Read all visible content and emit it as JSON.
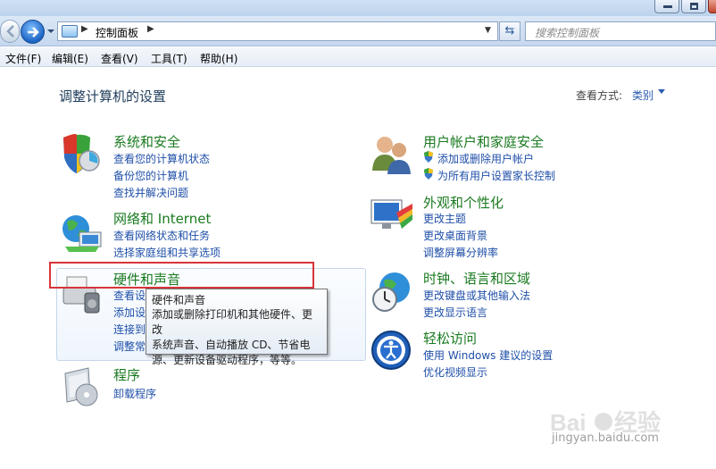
{
  "window": {
    "address": {
      "location": "控制面板"
    },
    "search": {
      "placeholder": "搜索控制面板"
    }
  },
  "menubar": {
    "items": [
      "文件(F)",
      "编辑(E)",
      "查看(V)",
      "工具(T)",
      "帮助(H)"
    ]
  },
  "main": {
    "title": "调整计算机的设置",
    "view_by_label": "查看方式:",
    "view_by_value": "类别",
    "categories": [
      {
        "title": "系统和安全",
        "links": [
          "查看您的计算机状态",
          "备份您的计算机",
          "查找并解决问题"
        ]
      },
      {
        "title": "网络和 Internet",
        "links": [
          "查看网络状态和任务",
          "选择家庭组和共享选项"
        ]
      },
      {
        "title": "硬件和声音",
        "links": [
          "查看设",
          "添加设",
          "连接到",
          "调整常"
        ]
      },
      {
        "title": "程序",
        "links": [
          "卸载程序"
        ]
      },
      {
        "title": "用户帐户和家庭安全",
        "links": [
          "添加或删除用户帐户",
          "为所有用户设置家长控制"
        ]
      },
      {
        "title": "外观和个性化",
        "links": [
          "更改主题",
          "更改桌面背景",
          "调整屏幕分辨率"
        ]
      },
      {
        "title": "时钟、语言和区域",
        "links": [
          "更改键盘或其他输入法",
          "更改显示语言"
        ]
      },
      {
        "title": "轻松访问",
        "links": [
          "使用 Windows 建议的设置",
          "优化视频显示"
        ]
      }
    ],
    "tooltip": {
      "title": "硬件和声音",
      "lines": [
        "添加或删除打印机和其他硬件、更改",
        "系统声音、自动播放 CD、节省电",
        "源、更新设备驱动程序，等等。"
      ]
    }
  },
  "watermark": {
    "text": "jingyan.baidu.com"
  },
  "colors": {
    "category_title": "#1a7a20",
    "link": "#1f4fa8",
    "highlight_box": "#d8353a"
  }
}
